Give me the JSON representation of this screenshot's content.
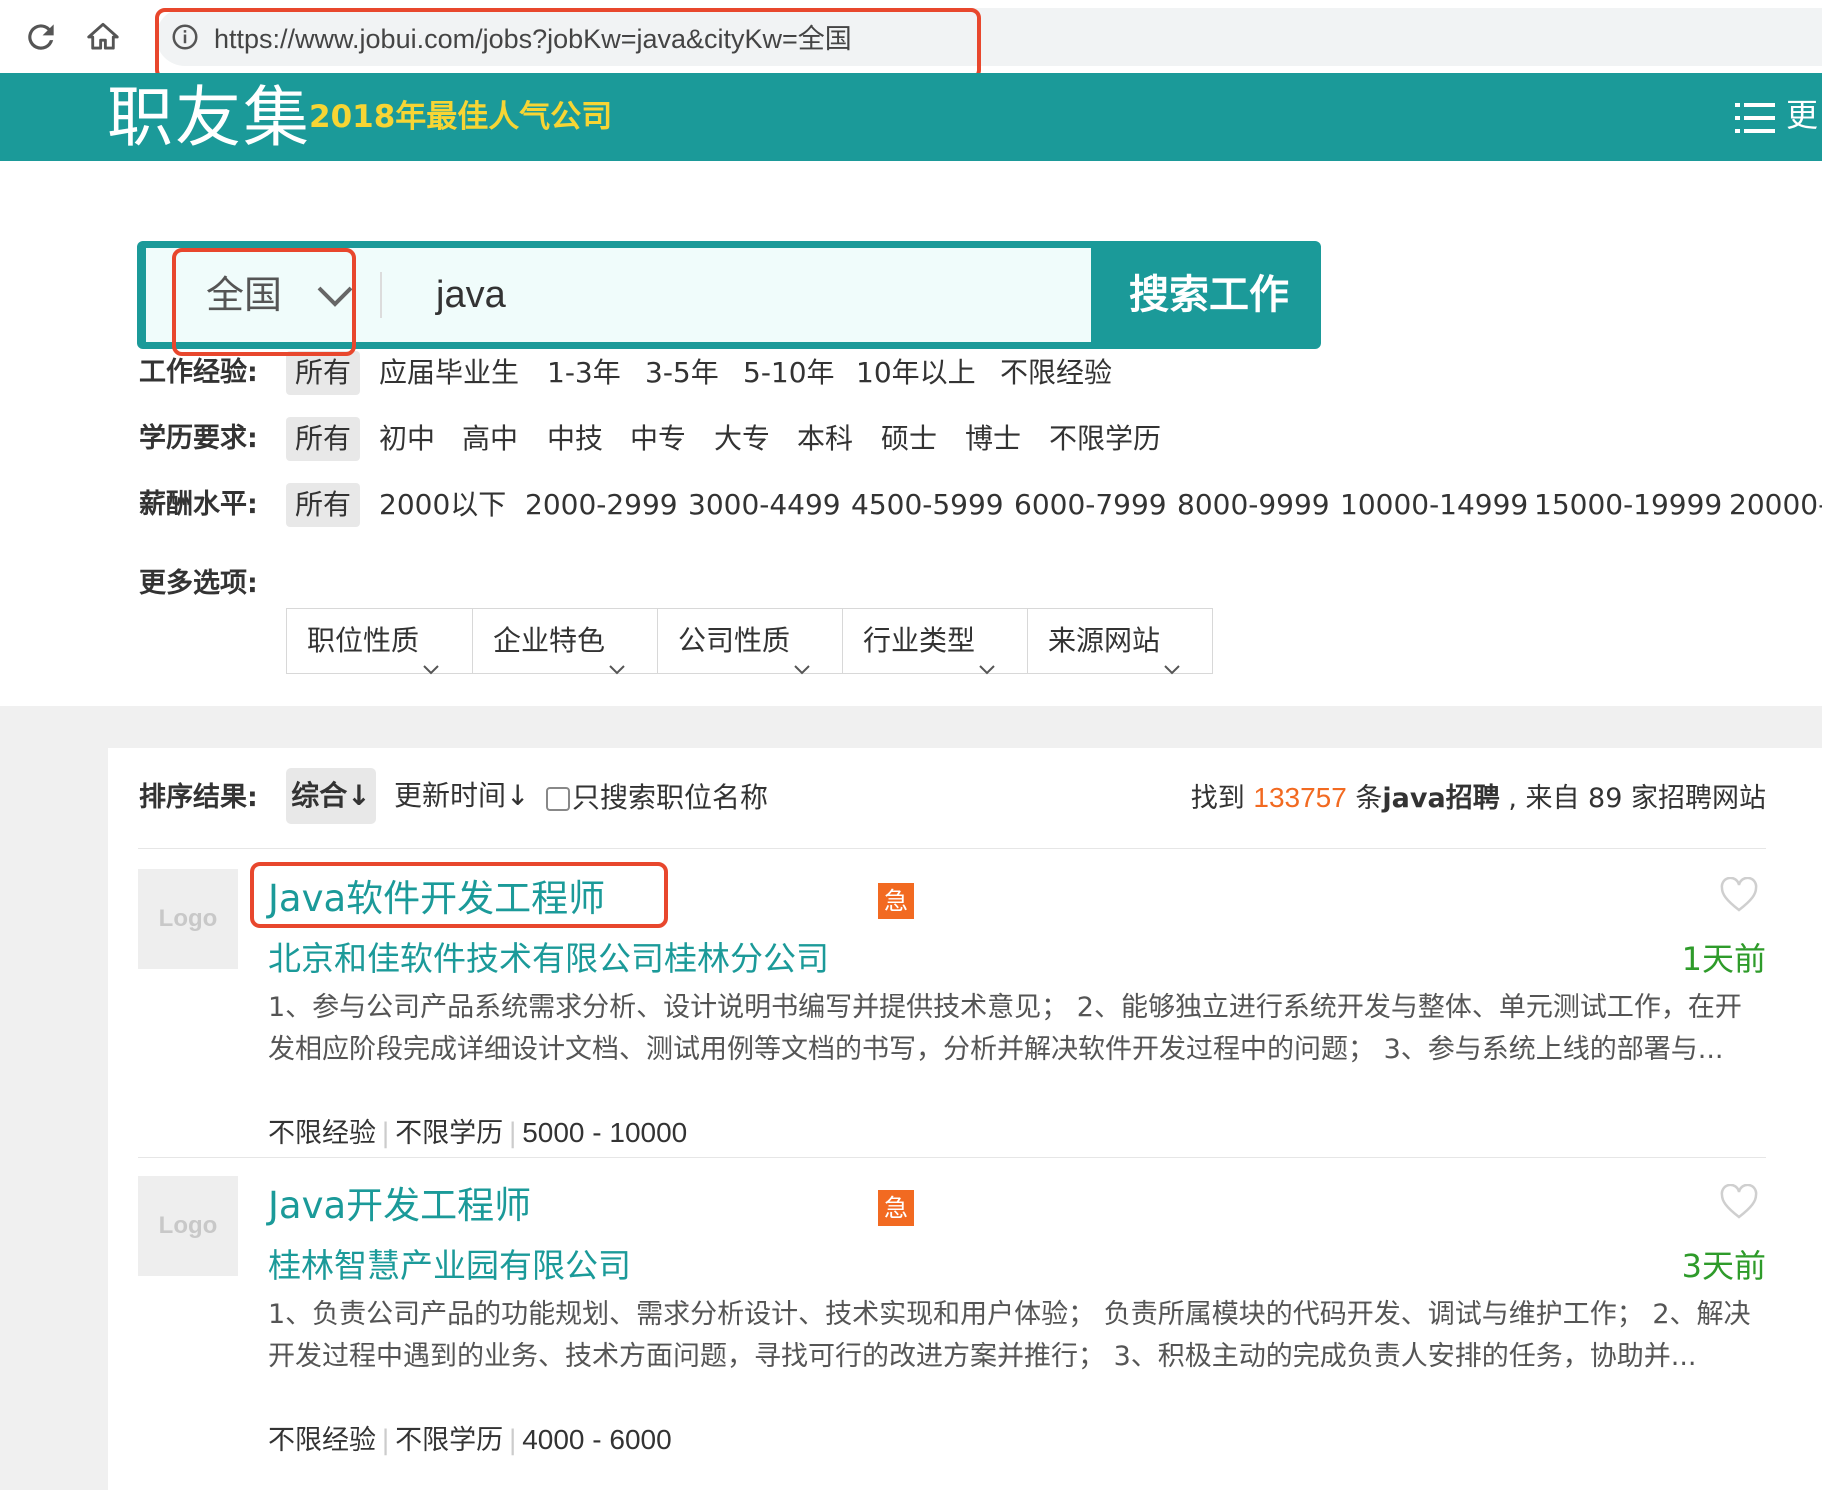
{
  "browser": {
    "url": "https://www.jobui.com/jobs?jobKw=java&cityKw=全国"
  },
  "header": {
    "logo": "职友集",
    "slogan": "2018年最佳人气公司",
    "menu_label": "更"
  },
  "search": {
    "city": "全国",
    "keyword": "java",
    "button": "搜索工作"
  },
  "filters": {
    "experience": {
      "label": "工作经验:",
      "options": [
        "所有",
        "应届毕业生",
        "1-3年",
        "3-5年",
        "5-10年",
        "10年以上",
        "不限经验"
      ]
    },
    "education": {
      "label": "学历要求:",
      "options": [
        "所有",
        "初中",
        "高中",
        "中技",
        "中专",
        "大专",
        "本科",
        "硕士",
        "博士",
        "不限学历"
      ]
    },
    "salary": {
      "label": "薪酬水平:",
      "options": [
        "所有",
        "2000以下",
        "2000-2999",
        "3000-4499",
        "4500-5999",
        "6000-7999",
        "8000-9999",
        "10000-14999",
        "15000-19999",
        "20000-"
      ]
    },
    "more": {
      "label": "更多选项:",
      "options": [
        "职位性质",
        "企业特色",
        "公司性质",
        "行业类型",
        "来源网站"
      ]
    }
  },
  "results": {
    "sort_label": "排序结果:",
    "sort_active": "综合↓",
    "sort_time": "更新时间↓",
    "title_only": "只搜索职位名称",
    "count_prefix": "找到",
    "count": "133757",
    "count_middle": "条",
    "count_keyword": "java招聘",
    "count_suffix": ", 来自 89 家招聘网站",
    "jobs": [
      {
        "logo": "Logo",
        "title": "Java软件开发工程师",
        "urgent": "急",
        "company": "北京和佳软件技术有限公司桂林分公司",
        "posted": "1天前",
        "desc": "1、参与公司产品系统需求分析、设计说明书编写并提供技术意见； 2、能够独立进行系统开发与整体、单元测试工作，在开发相应阶段完成详细设计文档、测试用例等文档的书写，分析并解决软件开发过程中的问题； 3、参与系统上线的部署与...",
        "experience": "不限经验",
        "education": "不限学历",
        "salary": "5000 - 10000"
      },
      {
        "logo": "Logo",
        "title": "Java开发工程师",
        "urgent": "急",
        "company": "桂林智慧产业园有限公司",
        "posted": "3天前",
        "desc": "1、负责公司产品的功能规划、需求分析设计、技术实现和用户体验； 负责所属模块的代码开发、调试与维护工作； 2、解决开发过程中遇到的业务、技术方面问题，寻找可行的改进方案并推行； 3、积极主动的完成负责人安排的任务，协助并...",
        "experience": "不限经验",
        "education": "不限学历",
        "salary": "4000 - 6000"
      }
    ]
  },
  "colors": {
    "brand": "#1b9a99",
    "slogan": "#f7d534",
    "accent": "#f26a21",
    "posted": "#2e9b2a",
    "annotation": "#e8472d"
  }
}
